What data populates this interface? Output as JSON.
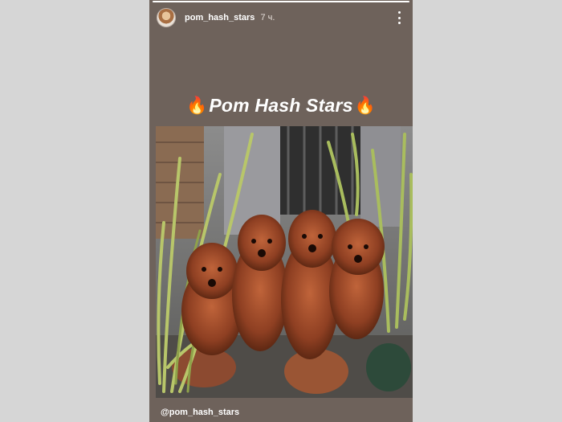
{
  "story": {
    "progress": 1.0,
    "username": "pom_hash_stars",
    "time_ago": "7 ч.",
    "title": "Pom Hash Stars",
    "title_emoji": "🔥",
    "caption": "@pom_hash_stars",
    "colors": {
      "background": "#6e625b",
      "page": "#d6d6d6"
    },
    "icons": {
      "menu": "more-vertical-icon",
      "fire": "fire-emoji-icon"
    }
  }
}
